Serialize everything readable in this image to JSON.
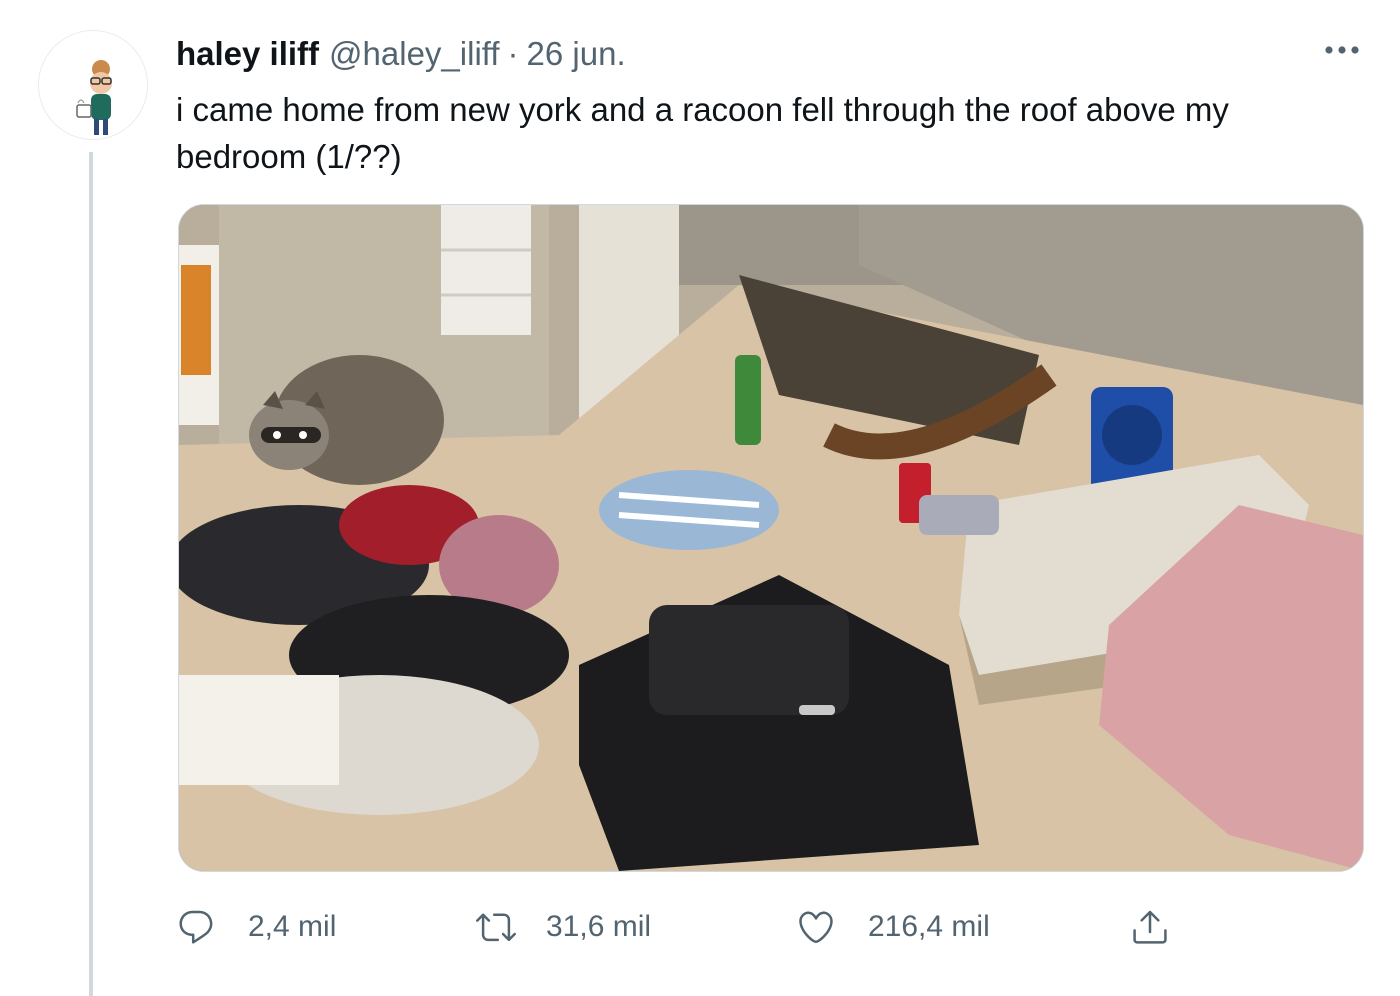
{
  "tweet": {
    "author_name": "haley iliff",
    "author_handle": "@haley_iliff",
    "separator": "·",
    "date": "26 jun.",
    "text": "i came home from new york and a racoon fell through the roof above my bedroom (1/??)"
  },
  "actions": {
    "replies": "2,4 mil",
    "retweets": "31,6 mil",
    "likes": "216,4 mil"
  },
  "icons": {
    "more": "more-horizontal-icon",
    "reply": "reply-icon",
    "retweet": "retweet-icon",
    "like": "heart-icon",
    "share": "share-icon"
  },
  "colors": {
    "text_primary": "#0f1419",
    "text_secondary": "#536471",
    "thread_line": "#cfd9de"
  }
}
